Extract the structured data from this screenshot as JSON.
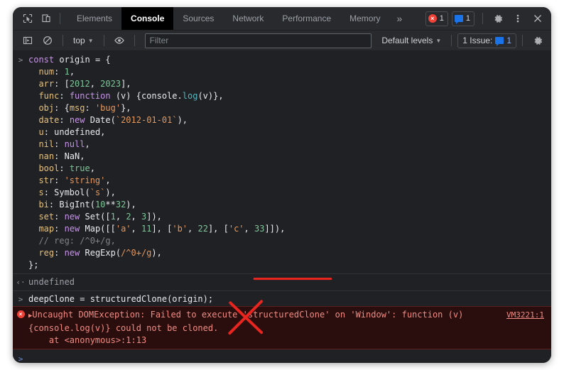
{
  "window": {
    "title": "DevTools Console"
  },
  "tabbar": {
    "inspect_icon": "inspect-cursor-icon",
    "device_icon": "device-toggle-icon",
    "tabs": [
      {
        "label": "Elements",
        "active": false
      },
      {
        "label": "Console",
        "active": true
      },
      {
        "label": "Sources",
        "active": false
      },
      {
        "label": "Network",
        "active": false
      },
      {
        "label": "Performance",
        "active": false
      },
      {
        "label": "Memory",
        "active": false
      }
    ],
    "more_label": "»",
    "error_count": "1",
    "message_count": "1",
    "settings_icon": "gear-icon",
    "menu_icon": "kebab-menu-icon",
    "close_icon": "close-icon"
  },
  "filterbar": {
    "sidebar_icon": "console-sidebar-icon",
    "clear_icon": "clear-console-icon",
    "context_label": "top",
    "eye_icon": "live-expression-icon",
    "filter_placeholder": "Filter",
    "filter_value": "",
    "levels_label": "Default levels",
    "issues_label": "1 Issue:",
    "issues_count": "1",
    "settings_icon": "console-settings-icon"
  },
  "console": {
    "prompt_glyph": ">",
    "result_glyph": "‹·",
    "input_lines": [
      [
        {
          "t": "const ",
          "c": "kw"
        },
        {
          "t": "origin",
          "c": "plain"
        },
        {
          "t": " = {",
          "c": "plain"
        }
      ],
      [
        {
          "t": "  num",
          "c": "prop"
        },
        {
          "t": ": ",
          "c": "plain"
        },
        {
          "t": "1",
          "c": "num"
        },
        {
          "t": ",",
          "c": "plain"
        }
      ],
      [
        {
          "t": "  arr",
          "c": "prop"
        },
        {
          "t": ": [",
          "c": "plain"
        },
        {
          "t": "2012",
          "c": "num"
        },
        {
          "t": ", ",
          "c": "plain"
        },
        {
          "t": "2023",
          "c": "num"
        },
        {
          "t": "],",
          "c": "plain"
        }
      ],
      [
        {
          "t": "  func",
          "c": "prop"
        },
        {
          "t": ": ",
          "c": "plain"
        },
        {
          "t": "function",
          "c": "kw"
        },
        {
          "t": " (v) {console.",
          "c": "plain"
        },
        {
          "t": "log",
          "c": "fn"
        },
        {
          "t": "(v)},",
          "c": "plain"
        }
      ],
      [
        {
          "t": "  obj",
          "c": "prop"
        },
        {
          "t": ": {",
          "c": "plain"
        },
        {
          "t": "msg",
          "c": "prop"
        },
        {
          "t": ": ",
          "c": "plain"
        },
        {
          "t": "'bug'",
          "c": "str"
        },
        {
          "t": "},",
          "c": "plain"
        }
      ],
      [
        {
          "t": "  date",
          "c": "prop"
        },
        {
          "t": ": ",
          "c": "plain"
        },
        {
          "t": "new",
          "c": "kw"
        },
        {
          "t": " Date(",
          "c": "plain"
        },
        {
          "t": "`2012-01-01`",
          "c": "str"
        },
        {
          "t": "),",
          "c": "plain"
        }
      ],
      [
        {
          "t": "  u",
          "c": "prop"
        },
        {
          "t": ": ",
          "c": "plain"
        },
        {
          "t": "undefined",
          "c": "plain"
        },
        {
          "t": ",",
          "c": "plain"
        }
      ],
      [
        {
          "t": "  nil",
          "c": "prop"
        },
        {
          "t": ": ",
          "c": "plain"
        },
        {
          "t": "null",
          "c": "kw"
        },
        {
          "t": ",",
          "c": "plain"
        }
      ],
      [
        {
          "t": "  nan",
          "c": "prop"
        },
        {
          "t": ": ",
          "c": "plain"
        },
        {
          "t": "NaN",
          "c": "plain"
        },
        {
          "t": ",",
          "c": "plain"
        }
      ],
      [
        {
          "t": "  bool",
          "c": "prop"
        },
        {
          "t": ": ",
          "c": "plain"
        },
        {
          "t": "true",
          "c": "num"
        },
        {
          "t": ",",
          "c": "plain"
        }
      ],
      [
        {
          "t": "  str",
          "c": "prop"
        },
        {
          "t": ": ",
          "c": "plain"
        },
        {
          "t": "'string'",
          "c": "str"
        },
        {
          "t": ",",
          "c": "plain"
        }
      ],
      [
        {
          "t": "  s",
          "c": "prop"
        },
        {
          "t": ": Symbol(",
          "c": "plain"
        },
        {
          "t": "`s`",
          "c": "str"
        },
        {
          "t": "),",
          "c": "plain"
        }
      ],
      [
        {
          "t": "  bi",
          "c": "prop"
        },
        {
          "t": ": BigInt(",
          "c": "plain"
        },
        {
          "t": "10",
          "c": "num"
        },
        {
          "t": "**",
          "c": "plain"
        },
        {
          "t": "32",
          "c": "num"
        },
        {
          "t": "),",
          "c": "plain"
        }
      ],
      [
        {
          "t": "  set",
          "c": "prop"
        },
        {
          "t": ": ",
          "c": "plain"
        },
        {
          "t": "new",
          "c": "kw"
        },
        {
          "t": " Set([",
          "c": "plain"
        },
        {
          "t": "1",
          "c": "num"
        },
        {
          "t": ", ",
          "c": "plain"
        },
        {
          "t": "2",
          "c": "num"
        },
        {
          "t": ", ",
          "c": "plain"
        },
        {
          "t": "3",
          "c": "num"
        },
        {
          "t": "]),",
          "c": "plain"
        }
      ],
      [
        {
          "t": "  map",
          "c": "prop"
        },
        {
          "t": ": ",
          "c": "plain"
        },
        {
          "t": "new",
          "c": "kw"
        },
        {
          "t": " Map([[",
          "c": "plain"
        },
        {
          "t": "'a'",
          "c": "str"
        },
        {
          "t": ", ",
          "c": "plain"
        },
        {
          "t": "11",
          "c": "num"
        },
        {
          "t": "], [",
          "c": "plain"
        },
        {
          "t": "'b'",
          "c": "str"
        },
        {
          "t": ", ",
          "c": "plain"
        },
        {
          "t": "22",
          "c": "num"
        },
        {
          "t": "], [",
          "c": "plain"
        },
        {
          "t": "'c'",
          "c": "str"
        },
        {
          "t": ", ",
          "c": "plain"
        },
        {
          "t": "33",
          "c": "num"
        },
        {
          "t": "]]),",
          "c": "plain"
        }
      ],
      [
        {
          "t": "  // reg: /^0+/g,",
          "c": "cmt"
        }
      ],
      [
        {
          "t": "  reg",
          "c": "prop"
        },
        {
          "t": ": ",
          "c": "plain"
        },
        {
          "t": "new",
          "c": "kw"
        },
        {
          "t": " RegExp(",
          "c": "plain"
        },
        {
          "t": "/^0+/g",
          "c": "str"
        },
        {
          "t": "),",
          "c": "plain"
        }
      ],
      [
        {
          "t": "};",
          "c": "plain"
        }
      ]
    ],
    "result_text": "undefined",
    "second_input": "deepClone = structuredClone(origin);",
    "error": {
      "line1": "Uncaught DOMException: Failed to execute 'structuredClone' on 'Window': function (v)",
      "line2": "{console.log(v)} could not be cloned.",
      "line3": "    at <anonymous>:1:13",
      "link": "VM3221:1",
      "icon": "error-circle-icon"
    },
    "annotations": {
      "underline_color": "#e8251f",
      "cross_color": "#e8251f",
      "underline_target": "structuredClone"
    }
  }
}
